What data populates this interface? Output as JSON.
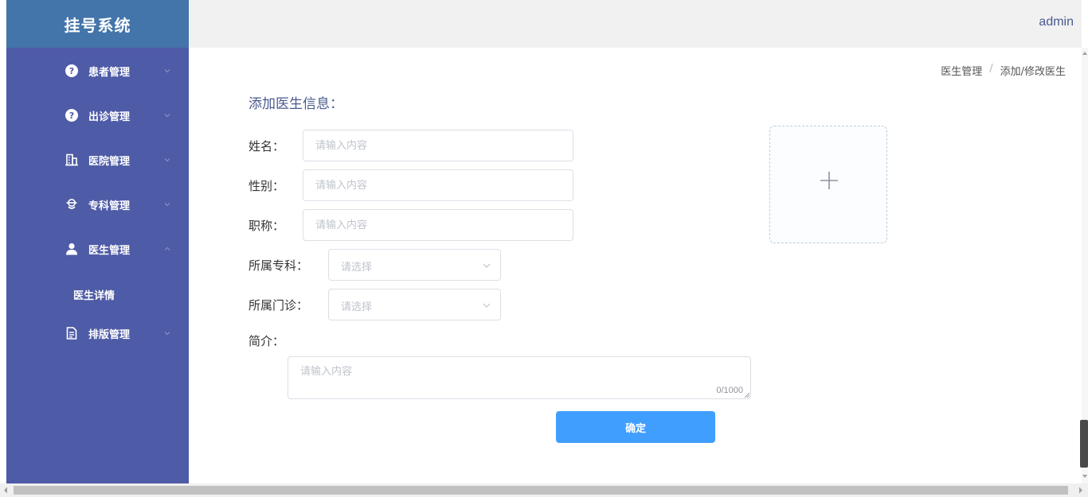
{
  "app": {
    "title": "挂号系统"
  },
  "header": {
    "user": "admin"
  },
  "sidebar": {
    "items": [
      {
        "label": "患者管理",
        "icon": "question-circle-icon",
        "expanded": false
      },
      {
        "label": "出诊管理",
        "icon": "question-circle-icon",
        "expanded": false
      },
      {
        "label": "医院管理",
        "icon": "building-icon",
        "expanded": false
      },
      {
        "label": "专科管理",
        "icon": "department-icon",
        "expanded": false
      },
      {
        "label": "医生管理",
        "icon": "user-icon",
        "expanded": true,
        "children": [
          {
            "label": "医生详情"
          }
        ]
      },
      {
        "label": "排版管理",
        "icon": "document-icon",
        "expanded": false
      }
    ]
  },
  "breadcrumb": {
    "parent": "医生管理",
    "separator": "/",
    "current": "添加/修改医生"
  },
  "form": {
    "title": "添加医生信息：",
    "name": {
      "label": "姓名：",
      "value": "",
      "placeholder": "请输入内容"
    },
    "gender": {
      "label": "性别：",
      "value": "",
      "placeholder": "请输入内容"
    },
    "title_field": {
      "label": "职称：",
      "value": "",
      "placeholder": "请输入内容"
    },
    "specialty": {
      "label": "所属专科：",
      "placeholder": "请选择"
    },
    "clinic": {
      "label": "所属门诊：",
      "placeholder": "请选择"
    },
    "intro": {
      "label": "简介：",
      "value": "",
      "placeholder": "请输入内容",
      "counter": "0/1000"
    },
    "submit_label": "确定"
  },
  "colors": {
    "sidebar_bg": "#4e5ba6",
    "logo_bg": "#4374aa",
    "primary_button": "#409eff",
    "header_bg": "#f1f1f1"
  }
}
